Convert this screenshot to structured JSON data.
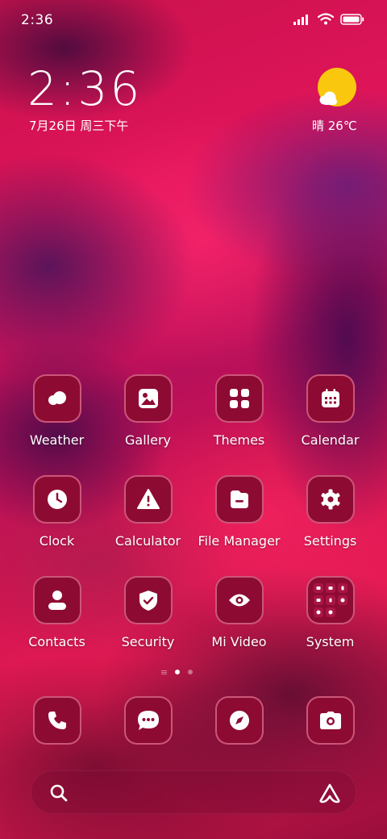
{
  "status_bar": {
    "time": "2:36",
    "icons": [
      "signal-icon",
      "wifi-icon",
      "battery-icon"
    ]
  },
  "clock_widget": {
    "time": "2:36",
    "date": "7月26日 周三下午"
  },
  "weather_widget": {
    "text": "晴 26℃",
    "icon": "sunny-cloud-icon"
  },
  "apps": [
    {
      "label": "Weather",
      "icon": "cloud-icon"
    },
    {
      "label": "Gallery",
      "icon": "image-icon"
    },
    {
      "label": "Themes",
      "icon": "grid-icon"
    },
    {
      "label": "Calendar",
      "icon": "calendar-icon"
    },
    {
      "label": "Clock",
      "icon": "clock-icon"
    },
    {
      "label": "Calculator",
      "icon": "warning-icon"
    },
    {
      "label": "File Manager",
      "icon": "folder-icon"
    },
    {
      "label": "Settings",
      "icon": "gear-icon"
    },
    {
      "label": "Contacts",
      "icon": "person-icon"
    },
    {
      "label": "Security",
      "icon": "shield-icon"
    },
    {
      "label": "Mi Video",
      "icon": "eye-icon"
    },
    {
      "label": "System",
      "icon": "folder-grid-icon"
    }
  ],
  "page_indicator": {
    "pages": 2,
    "active": 1
  },
  "dock": [
    {
      "icon": "phone-icon"
    },
    {
      "icon": "message-icon"
    },
    {
      "icon": "compass-icon"
    },
    {
      "icon": "camera-icon"
    }
  ],
  "search_bar": {
    "left_icon": "search-icon",
    "right_icon": "assistant-icon"
  },
  "colors": {
    "icon_tile": "#8d0b33",
    "weather_sun": "#f9c80e",
    "text": "#ffffff"
  }
}
